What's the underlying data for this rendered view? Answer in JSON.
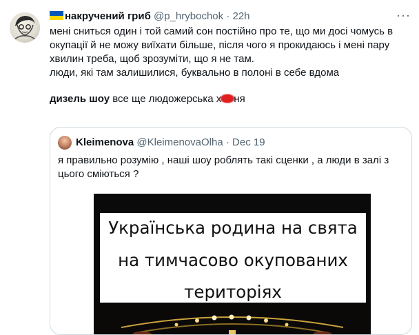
{
  "tweet": {
    "author_name": "накручений гриб",
    "handle": "@p_hrybochok",
    "separator": "·",
    "time": "22h",
    "more_icon": "more-horizontal-icon",
    "lines": [
      "мені сниться один і той самий сон постійно про те, що ми досі чомусь в",
      "окупації й не можу виїхати більше, після чого я прокидаюсь і мені пару",
      "хвилин треба, щоб зрозуміти, що я не там.",
      "люди, які там залишилися, буквально  в полоні в себе вдома"
    ],
    "last_line": {
      "bold": "дизель шоу",
      "text_before": " все ще людожерська х",
      "text_after": "ня"
    },
    "flag_colors": {
      "top": "#0057b7",
      "bottom": "#ffd700"
    }
  },
  "quote": {
    "author_name": "Kleimenova",
    "handle": "@KleimenovaOlha",
    "separator": "·",
    "time": "Dec 19",
    "lines": [
      "я правильно розумію , наші шоу роблять такі сценки , а люди в залі з",
      "цього сміються ?"
    ],
    "image_caption": [
      "Українська родина на свята",
      "на тимчасово окупованих",
      "територіях"
    ]
  },
  "colors": {
    "text": "#0f1419",
    "secondary": "#536471",
    "border": "#cfd9de",
    "censor_mark": "#e02020"
  }
}
